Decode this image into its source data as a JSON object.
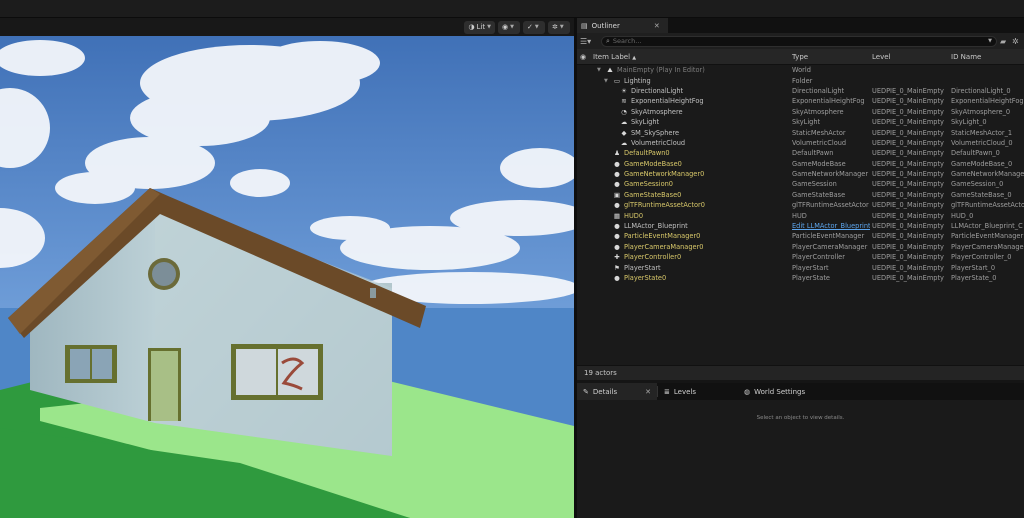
{
  "viewport": {
    "buttons": [
      {
        "icon": "lit-sphere-icon",
        "label": "Lit"
      },
      {
        "icon": "eye-icon",
        "label": ""
      },
      {
        "icon": "realtime-check-icon",
        "label": ""
      },
      {
        "icon": "gear-icon",
        "label": ""
      }
    ]
  },
  "outliner": {
    "tab_label": "Outliner",
    "search_placeholder": "Search...",
    "columns": {
      "label": "Item Label",
      "sort": "▲",
      "type": "Type",
      "level": "Level",
      "id": "ID Name"
    },
    "rows": [
      {
        "indent": 0,
        "arrow": "▼",
        "icon": "world-icon",
        "label": "MainEmpty (Play In Editor)",
        "type": "World",
        "level": "",
        "id": "",
        "style": "dim"
      },
      {
        "indent": 1,
        "arrow": "▼",
        "icon": "folder-icon",
        "label": "Lighting",
        "type": "Folder",
        "level": "",
        "id": "",
        "style": "plain"
      },
      {
        "indent": 2,
        "arrow": "",
        "icon": "directional-light-icon",
        "label": "DirectionalLight",
        "type": "DirectionalLight",
        "level": "UEDPIE_0_MainEmpty",
        "id": "DirectionalLight_0",
        "style": "plain"
      },
      {
        "indent": 2,
        "arrow": "",
        "icon": "fog-icon",
        "label": "ExponentialHeightFog",
        "type": "ExponentialHeightFog",
        "level": "UEDPIE_0_MainEmpty",
        "id": "ExponentialHeightFog",
        "style": "plain"
      },
      {
        "indent": 2,
        "arrow": "",
        "icon": "atmosphere-icon",
        "label": "SkyAtmosphere",
        "type": "SkyAtmosphere",
        "level": "UEDPIE_0_MainEmpty",
        "id": "SkyAtmosphere_0",
        "style": "plain"
      },
      {
        "indent": 2,
        "arrow": "",
        "icon": "skylight-icon",
        "label": "SkyLight",
        "type": "SkyLight",
        "level": "UEDPIE_0_MainEmpty",
        "id": "SkyLight_0",
        "style": "plain"
      },
      {
        "indent": 2,
        "arrow": "",
        "icon": "static-mesh-icon",
        "label": "SM_SkySphere",
        "type": "StaticMeshActor",
        "level": "UEDPIE_0_MainEmpty",
        "id": "StaticMeshActor_1",
        "style": "plain"
      },
      {
        "indent": 2,
        "arrow": "",
        "icon": "cloud-icon",
        "label": "VolumetricCloud",
        "type": "VolumetricCloud",
        "level": "UEDPIE_0_MainEmpty",
        "id": "VolumetricCloud_0",
        "style": "plain"
      },
      {
        "indent": 1,
        "arrow": "",
        "icon": "pawn-icon",
        "label": "DefaultPawn0",
        "type": "DefaultPawn",
        "level": "UEDPIE_0_MainEmpty",
        "id": "DefaultPawn_0",
        "style": "yellow"
      },
      {
        "indent": 1,
        "arrow": "",
        "icon": "actor-icon",
        "label": "GameModeBase0",
        "type": "GameModeBase",
        "level": "UEDPIE_0_MainEmpty",
        "id": "GameModeBase_0",
        "style": "yellow"
      },
      {
        "indent": 1,
        "arrow": "",
        "icon": "actor-icon",
        "label": "GameNetworkManager0",
        "type": "GameNetworkManager",
        "level": "UEDPIE_0_MainEmpty",
        "id": "GameNetworkManager",
        "style": "yellow"
      },
      {
        "indent": 1,
        "arrow": "",
        "icon": "actor-icon",
        "label": "GameSession0",
        "type": "GameSession",
        "level": "UEDPIE_0_MainEmpty",
        "id": "GameSession_0",
        "style": "yellow"
      },
      {
        "indent": 1,
        "arrow": "",
        "icon": "game-state-icon",
        "label": "GameStateBase0",
        "type": "GameStateBase",
        "level": "UEDPIE_0_MainEmpty",
        "id": "GameStateBase_0",
        "style": "yellow"
      },
      {
        "indent": 1,
        "arrow": "",
        "icon": "actor-icon",
        "label": "glTFRuntimeAssetActor0",
        "type": "glTFRuntimeAssetActor",
        "level": "UEDPIE_0_MainEmpty",
        "id": "glTFRuntimeAssetActor",
        "style": "yellow"
      },
      {
        "indent": 1,
        "arrow": "",
        "icon": "hud-icon",
        "label": "HUD0",
        "type": "HUD",
        "level": "UEDPIE_0_MainEmpty",
        "id": "HUD_0",
        "style": "yellow"
      },
      {
        "indent": 1,
        "arrow": "",
        "icon": "actor-icon",
        "label": "LLMActor_Blueprint",
        "type": "Edit LLMActor_Blueprint",
        "level": "UEDPIE_0_MainEmpty",
        "id": "LLMActor_Blueprint_C",
        "style": "plain",
        "type_link": true
      },
      {
        "indent": 1,
        "arrow": "",
        "icon": "actor-icon",
        "label": "ParticleEventManager0",
        "type": "ParticleEventManager",
        "level": "UEDPIE_0_MainEmpty",
        "id": "ParticleEventManager",
        "style": "yellow"
      },
      {
        "indent": 1,
        "arrow": "",
        "icon": "actor-icon",
        "label": "PlayerCameraManager0",
        "type": "PlayerCameraManager",
        "level": "UEDPIE_0_MainEmpty",
        "id": "PlayerCameraManager",
        "style": "yellow"
      },
      {
        "indent": 1,
        "arrow": "",
        "icon": "controller-icon",
        "label": "PlayerController0",
        "type": "PlayerController",
        "level": "UEDPIE_0_MainEmpty",
        "id": "PlayerController_0",
        "style": "yellow"
      },
      {
        "indent": 1,
        "arrow": "",
        "icon": "player-start-icon",
        "label": "PlayerStart",
        "type": "PlayerStart",
        "level": "UEDPIE_0_MainEmpty",
        "id": "PlayerStart_0",
        "style": "plain"
      },
      {
        "indent": 1,
        "arrow": "",
        "icon": "actor-icon",
        "label": "PlayerState0",
        "type": "PlayerState",
        "level": "UEDPIE_0_MainEmpty",
        "id": "PlayerState_0",
        "style": "yellow"
      }
    ],
    "status": "19 actors"
  },
  "details": {
    "tabs": [
      {
        "icon": "pencil-icon",
        "label": "Details",
        "active": true
      },
      {
        "icon": "levels-icon",
        "label": "Levels",
        "active": false
      },
      {
        "icon": "globe-icon",
        "label": "World Settings",
        "active": false
      }
    ],
    "empty_message": "Select an object to view details."
  },
  "glyphs": {
    "world-icon": "⛰",
    "folder-icon": "▭",
    "directional-light-icon": "☀",
    "fog-icon": "≋",
    "atmosphere-icon": "◔",
    "skylight-icon": "☁",
    "static-mesh-icon": "◆",
    "cloud-icon": "☁",
    "pawn-icon": "♟",
    "actor-icon": "●",
    "game-state-icon": "▣",
    "hud-icon": "▦",
    "controller-icon": "✚",
    "player-start-icon": "⚑",
    "pencil-icon": "✎",
    "levels-icon": "≣",
    "globe-icon": "◍",
    "lit-sphere-icon": "◑",
    "eye-icon": "◉",
    "realtime-check-icon": "✓",
    "gear-icon": "✲"
  }
}
